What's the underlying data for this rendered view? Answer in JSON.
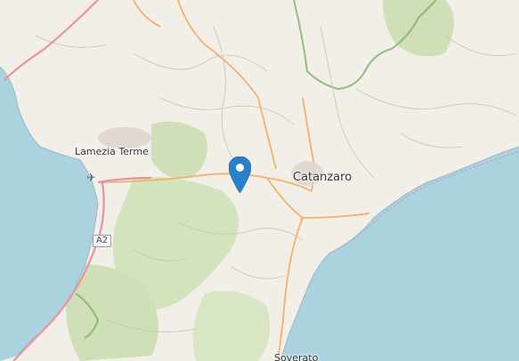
{
  "map": {
    "place_labels": {
      "lamezia_terme": "Lamezia Terme",
      "catanzaro": "Catanzaro",
      "soverato": "Soverato"
    },
    "road_shield": "A2",
    "marker": {
      "icon": "map-pin-icon",
      "color": "#2a81cb"
    },
    "airport_icon": "airplane-icon",
    "colors": {
      "sea": "#aad3df",
      "land": "#f2efe9",
      "forest": "#c8dcb0",
      "primary_road": "#f3b06e",
      "motorway": "#e892a2",
      "boundary": "#7fae6a"
    }
  }
}
